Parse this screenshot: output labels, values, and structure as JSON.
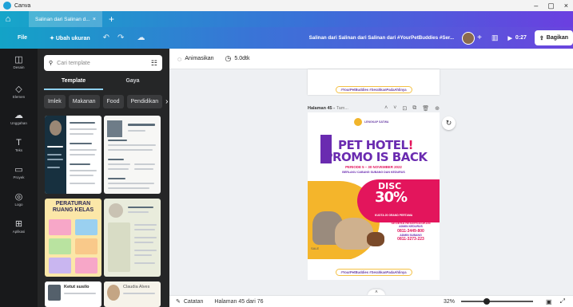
{
  "window": {
    "title": "Canva"
  },
  "tabs": {
    "document": "Salinan dari Salinan d...",
    "close": "×",
    "new": "+"
  },
  "toolbar": {
    "file": "File",
    "resize": "✦ Ubah ukuran",
    "doc_title": "Salinan dari Salinan dari Salinan dari #YourPetBuddies #Ser...",
    "play_time": "0:27",
    "share": "Bagikan"
  },
  "rail": [
    {
      "label": "Desain",
      "icon": "layout-icon",
      "glyph": "◫"
    },
    {
      "label": "Elemen",
      "icon": "shapes-icon",
      "glyph": "◇"
    },
    {
      "label": "Unggahan",
      "icon": "upload-icon",
      "glyph": "☁"
    },
    {
      "label": "Teks",
      "icon": "text-icon",
      "glyph": "T"
    },
    {
      "label": "Proyek",
      "icon": "folder-icon",
      "glyph": "▭"
    },
    {
      "label": "Logo",
      "icon": "logo-icon",
      "glyph": "◎"
    },
    {
      "label": "Aplikasi",
      "icon": "apps-icon",
      "glyph": "⊞"
    }
  ],
  "panel": {
    "search_placeholder": "Cari template",
    "tabs": [
      "Template",
      "Gaya"
    ],
    "chips": [
      "Imlek",
      "Makanan",
      "Food",
      "Pendidikan"
    ],
    "thumb_text": {
      "resume_name": "Muhammad Pata",
      "resume_left": "Ketut Susila",
      "kids_title": "PERATURAN RUANG KELAS",
      "bottom_left": "Ketut susilo",
      "bottom_right": "Claudia Alves"
    }
  },
  "subbar": {
    "animate": "Animasikan",
    "duration": "5.0dtk"
  },
  "canvas": {
    "hashtag": "#YourPetBuddies #SerahkanPadaAhlinya",
    "page_label": "Halaman 45 -",
    "page_sub": "Tam...",
    "poster": {
      "brand": "LENGKAP SATWA",
      "headline_1": "PET HOTEL",
      "headline_2": "PROMO IS BACK",
      "exclaim": "!",
      "dates": "PERIODE 5 – 30 NOVEMBER 2022",
      "subline": "BERLAKU CABANG SUBANG DAN KEDURUS",
      "disc": "DISC",
      "percent": "30%",
      "disc_note": "KUOTA 20 GRAND PERTAMA",
      "reserve": "SEGERA RESERVASIKAN",
      "admin1": "ADMIN KEDURUS",
      "phone1": "0811-3449-800",
      "admin2": "ADMIN SUBANG",
      "phone2": "0811-3273-223",
      "stamp": "SALE"
    }
  },
  "bottombar": {
    "notes": "Catatan",
    "page": "Halaman 45 dari 76",
    "zoom": "32%"
  },
  "colors": {
    "rail": "#18191b",
    "panel": "#252627",
    "accent_purple": "#6a2bb0",
    "accent_pink": "#e3155c",
    "accent_yellow": "#f4b52b"
  }
}
